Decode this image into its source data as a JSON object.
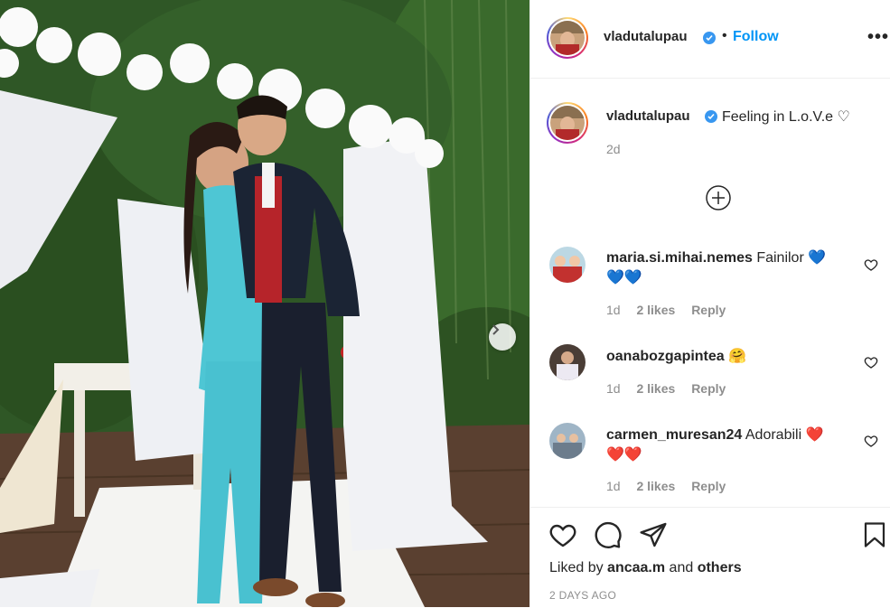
{
  "post": {
    "username": "vladutalupau",
    "follow_label": "Follow",
    "dot": "•",
    "more_label": "•••",
    "caption": "Feeling in L.o.V.e ♡",
    "caption_time": "2d"
  },
  "comments": [
    {
      "username": "maria.si.mihai.nemes",
      "text": "Fainilor",
      "emoji_line": "💙💙",
      "trailing_emoji": "💙",
      "time": "1d",
      "likes": "2 likes",
      "reply": "Reply"
    },
    {
      "username": "oanabozgapintea",
      "text": "",
      "emoji_line": "",
      "trailing_emoji": "🤗",
      "time": "1d",
      "likes": "2 likes",
      "reply": "Reply"
    },
    {
      "username": "carmen_muresan24",
      "text": "Adorabili",
      "emoji_line": "❤️❤️",
      "trailing_emoji": "❤️",
      "time": "1d",
      "likes": "2 likes",
      "reply": "Reply"
    }
  ],
  "footer": {
    "liked_prefix": "Liked by",
    "liked_user": "ancaa.m",
    "liked_and": "and",
    "liked_others": "others",
    "date": "2 DAYS AGO"
  },
  "icons": [
    "heart-icon",
    "comment-icon",
    "share-icon",
    "bookmark-icon",
    "plus-circle-icon",
    "chevron-right-icon",
    "verified-icon"
  ],
  "colors": {
    "accent": "#0095f6",
    "verified": "#3897f0",
    "meta": "#8e8e8e",
    "text": "#262626"
  }
}
